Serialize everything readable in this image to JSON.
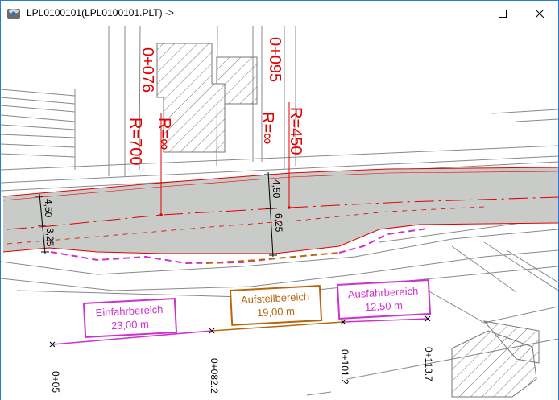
{
  "window": {
    "title": "LPL0100101(LPL0100101.PLT) ->"
  },
  "stations": [
    {
      "label": "0+076",
      "radius": "R=∞",
      "radius2": "R=700"
    },
    {
      "label": "0+095",
      "radius": "R=∞",
      "radius2": "R=450"
    }
  ],
  "widths": [
    "4,50",
    "3,25",
    "4,50",
    "6,25"
  ],
  "zones": [
    {
      "name": "Einfahrbereich",
      "length": "23,00 m",
      "color": "#cc33cc"
    },
    {
      "name": "Aufstellbereich",
      "length": "19,00 m",
      "color": "#b8660b"
    },
    {
      "name": "Ausfahrbereich",
      "length": "12,50 m",
      "color": "#cc33cc"
    }
  ],
  "axis_labels": [
    "0+05",
    "0+082.2",
    "0+101.2",
    "0+113.7"
  ],
  "colors": {
    "road_fill": "#c8cbc8",
    "alignment": "#e00000",
    "linework": "#888888"
  }
}
